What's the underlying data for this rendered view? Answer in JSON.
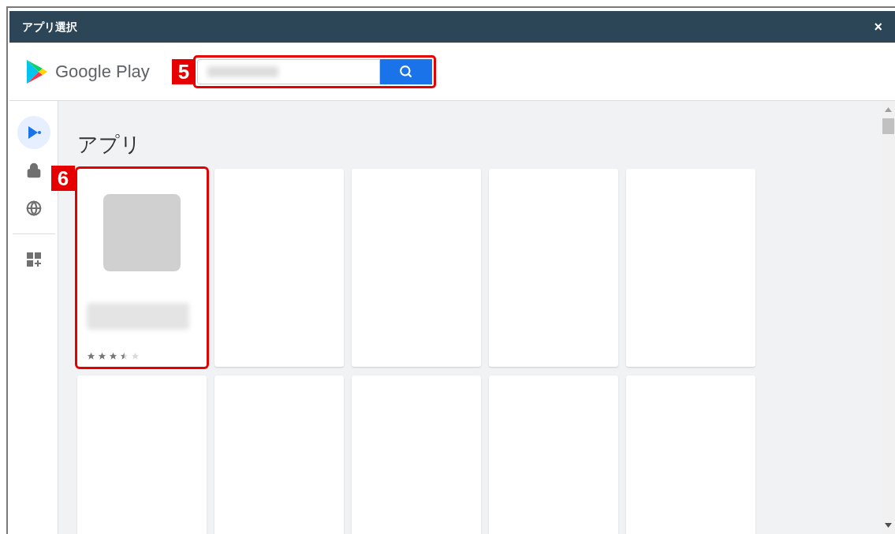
{
  "window": {
    "title": "アプリ選択",
    "close": "×"
  },
  "header": {
    "logo_text": "Google Play",
    "search_callout": "5"
  },
  "sidebar": {
    "items": [
      {
        "kind": "play",
        "selected": true
      },
      {
        "kind": "lock",
        "selected": false
      },
      {
        "kind": "globe",
        "selected": false
      },
      {
        "kind": "divider"
      },
      {
        "kind": "apps",
        "selected": false
      }
    ]
  },
  "heading": "アプリ",
  "cards": [
    {
      "kind": "app",
      "stars": 3.5,
      "callout": "6"
    },
    {
      "kind": "blank"
    },
    {
      "kind": "blank"
    },
    {
      "kind": "blank"
    },
    {
      "kind": "blank"
    },
    {
      "kind": "blank"
    },
    {
      "kind": "blank"
    },
    {
      "kind": "blank"
    },
    {
      "kind": "blank"
    },
    {
      "kind": "blank"
    }
  ]
}
